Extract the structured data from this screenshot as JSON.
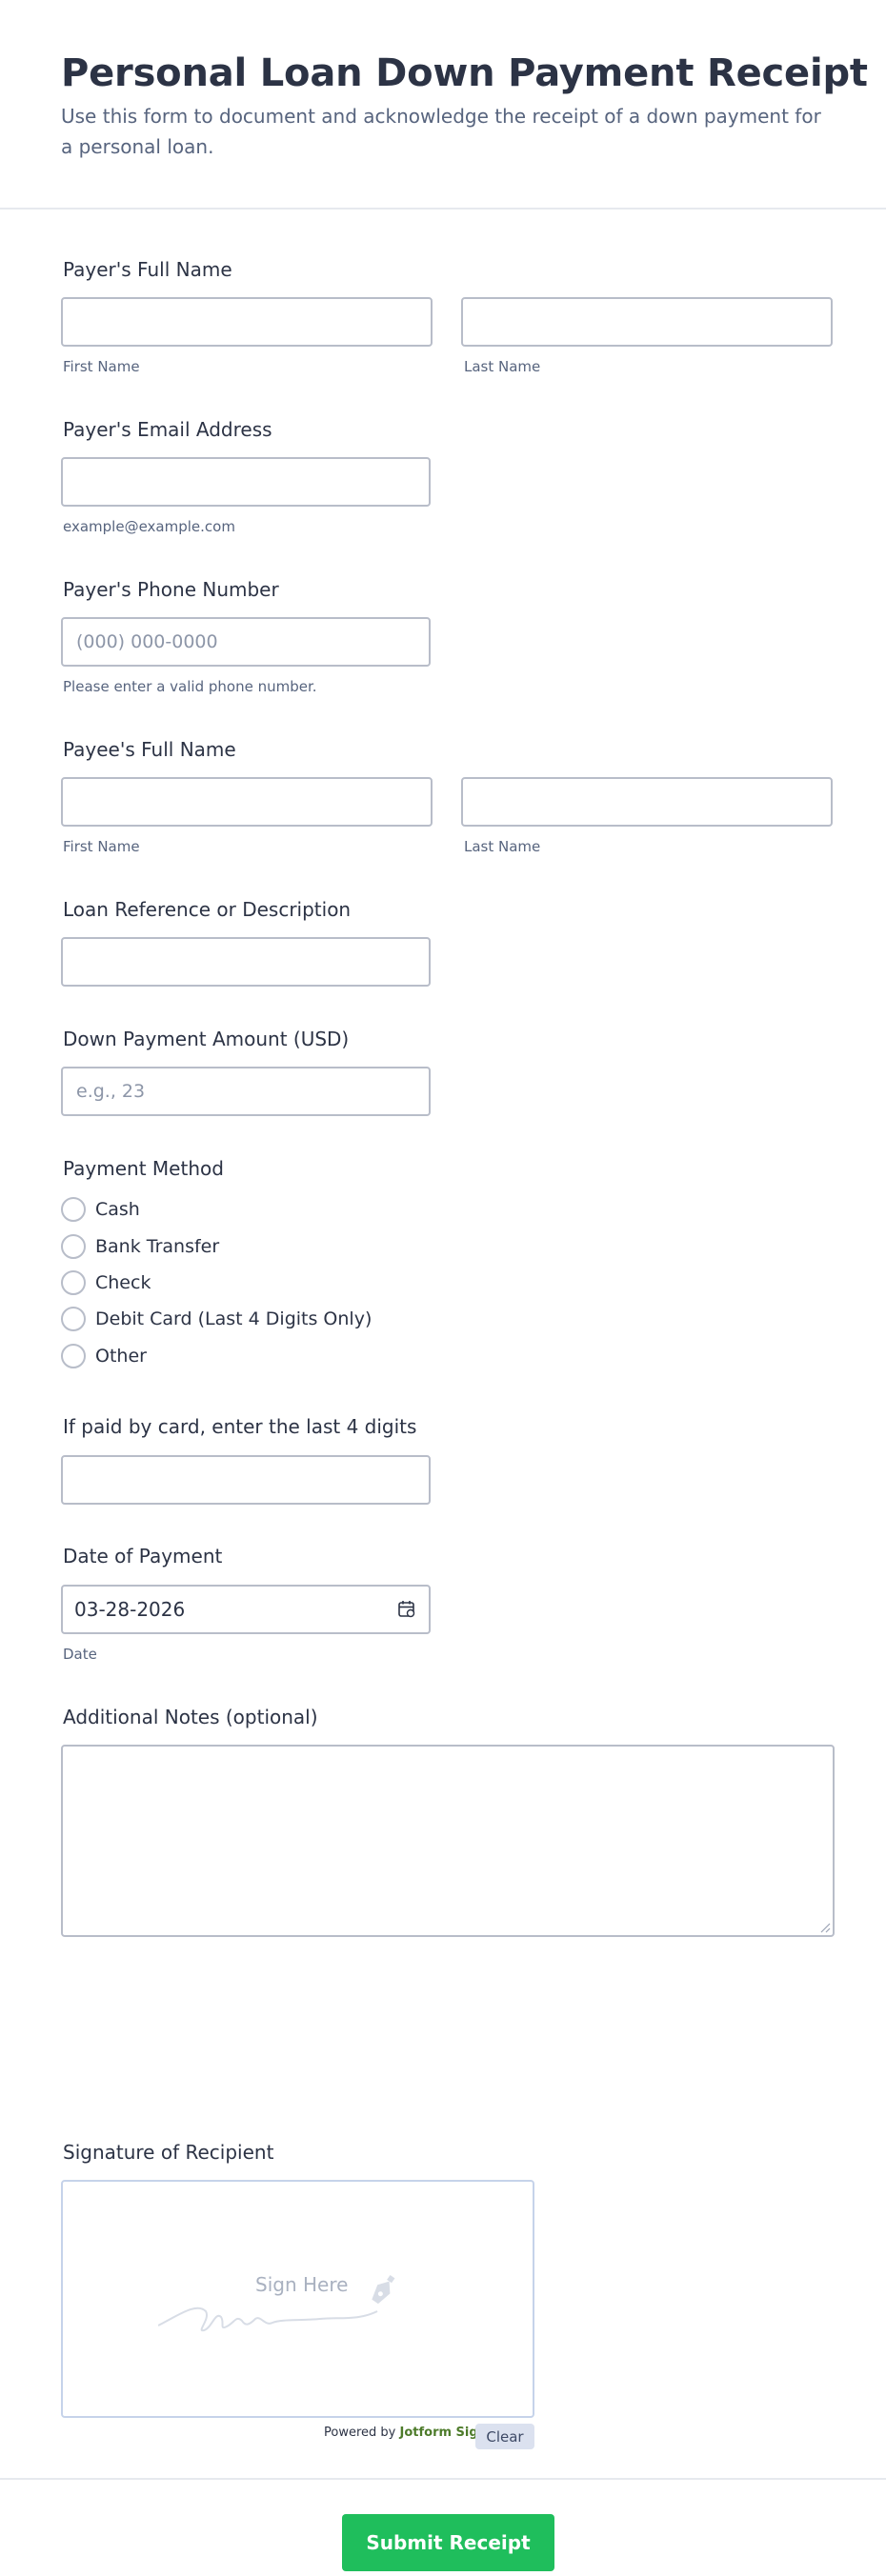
{
  "header": {
    "title": "Personal Loan Down Payment Receipt",
    "subtitle": "Use this form to document and acknowledge the receipt of a down payment for a personal loan."
  },
  "payer_name": {
    "label": "Payer's Full Name",
    "first_sub": "First Name",
    "last_sub": "Last Name",
    "first_value": "",
    "last_value": ""
  },
  "payer_email": {
    "label": "Payer's Email Address",
    "sublabel": "example@example.com",
    "value": ""
  },
  "payer_phone": {
    "label": "Payer's Phone Number",
    "placeholder": "(000) 000-0000",
    "sublabel": "Please enter a valid phone number.",
    "value": ""
  },
  "payee_name": {
    "label": "Payee's Full Name",
    "first_sub": "First Name",
    "last_sub": "Last Name",
    "first_value": "",
    "last_value": ""
  },
  "loan_reference": {
    "label": "Loan Reference or Description",
    "value": ""
  },
  "amount": {
    "label": "Down Payment Amount (USD)",
    "placeholder": "e.g., 23",
    "value": ""
  },
  "payment_method": {
    "label": "Payment Method",
    "options": [
      "Cash",
      "Bank Transfer",
      "Check",
      "Debit Card (Last 4 Digits Only)",
      "Other"
    ],
    "selected": null
  },
  "card_digits": {
    "label": "If paid by card, enter the last 4 digits",
    "value": ""
  },
  "payment_date": {
    "label": "Date of Payment",
    "value": "03-28-2026",
    "sublabel": "Date",
    "icon": "calendar-icon"
  },
  "notes": {
    "label": "Additional Notes (optional)",
    "value": ""
  },
  "signature": {
    "label": "Signature of Recipient",
    "placeholder": "Sign Here",
    "powered_prefix": "Powered by",
    "powered_brand": "Jotform Sign",
    "clear_label": "Clear"
  },
  "submit": {
    "label": "Submit Receipt"
  },
  "colors": {
    "submit": "#1fbe5c",
    "border": "#b8bdc9",
    "text": "#2c3345",
    "muted": "#57647e"
  }
}
